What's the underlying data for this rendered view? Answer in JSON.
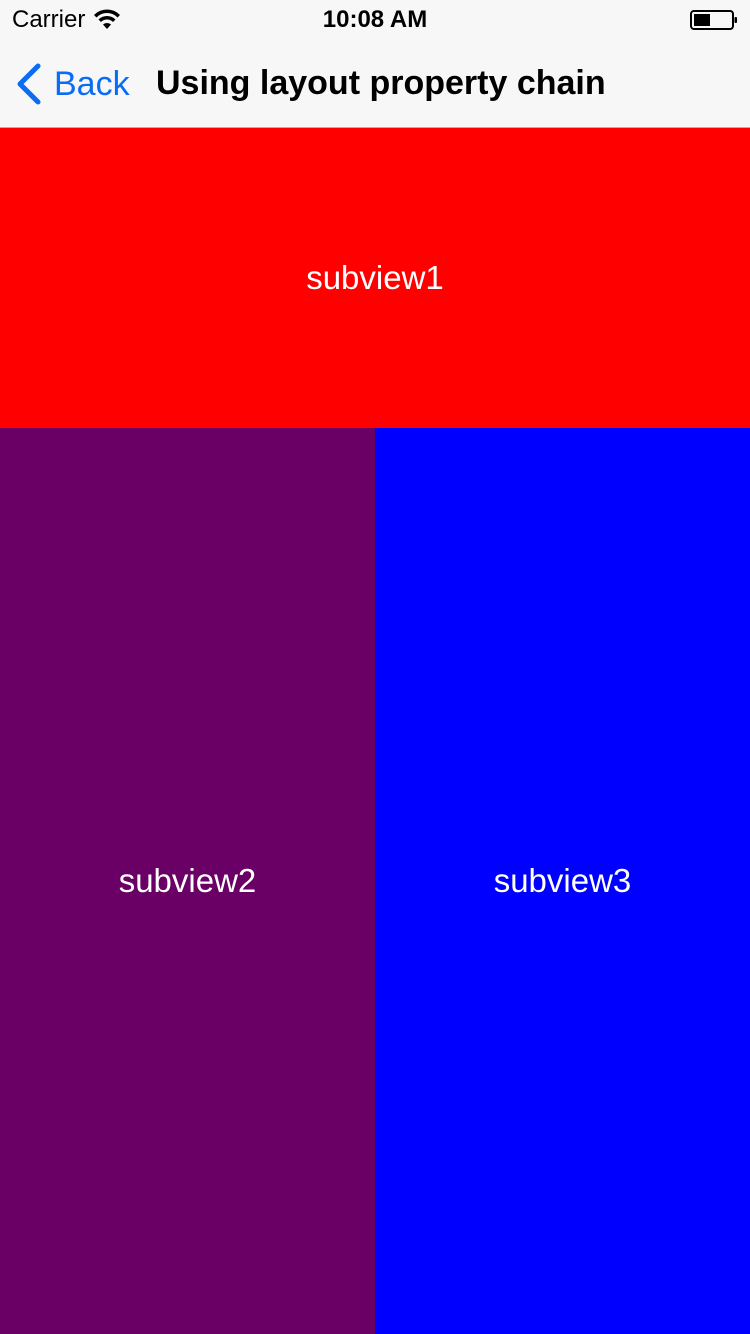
{
  "status_bar": {
    "carrier": "Carrier",
    "time": "10:08 AM",
    "wifi_icon": "wifi-icon",
    "battery_icon": "battery-icon"
  },
  "nav_bar": {
    "back_label": "Back",
    "back_icon": "chevron-left-icon",
    "title": "Using layout property chain",
    "tint_color": "#0a6cf5"
  },
  "subviews": [
    {
      "label": "subview1",
      "color": "#ff0000"
    },
    {
      "label": "subview2",
      "color": "#6a0066"
    },
    {
      "label": "subview3",
      "color": "#0000ff"
    }
  ]
}
